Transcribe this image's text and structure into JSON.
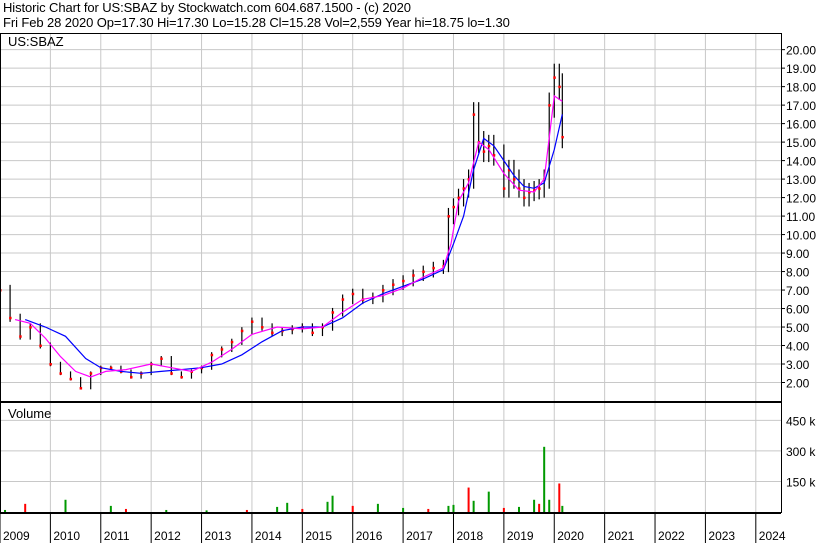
{
  "header": {
    "line1": "Historic Chart for US:SBAZ by Stockwatch.com 604.687.1500 - (c) 2020",
    "line2": "Fri Feb 28 2020   Op=17.30   Hi=17.30   Lo=15.28   Cl=15.28   Vol=2,559   Year hi=18.75   lo=1.30"
  },
  "colors": {
    "price_bar": "#000000",
    "moving_avg_fast": "#ff00ff",
    "moving_avg_slow": "#0000ff",
    "close_marker": "#ff0000",
    "volume_up": "#009900",
    "volume_down": "#ff0000",
    "grid": "#c8c8c8"
  },
  "chart_data": [
    {
      "type": "line",
      "title": "US:SBAZ",
      "y_axis_side": "right",
      "ylim": [
        1.0,
        20.9
      ],
      "y_ticks": [
        "2.00",
        "3.00",
        "4.00",
        "5.00",
        "6.00",
        "7.00",
        "8.00",
        "9.00",
        "10.00",
        "11.00",
        "12.00",
        "13.00",
        "14.00",
        "15.00",
        "16.00",
        "17.00",
        "18.00",
        "19.00",
        "20.00"
      ],
      "x_ticks": [
        "2009",
        "2010",
        "2011",
        "2012",
        "2013",
        "2014",
        "2015",
        "2016",
        "2017",
        "2018",
        "2019",
        "2020",
        "2021",
        "2022",
        "2023",
        "2024"
      ],
      "grid": true,
      "series": [
        {
          "name": "price",
          "x": [
            2009.0,
            2009.2,
            2009.4,
            2009.6,
            2009.8,
            2010.0,
            2010.2,
            2010.4,
            2010.6,
            2010.8,
            2011.0,
            2011.2,
            2011.4,
            2011.6,
            2011.8,
            2012.0,
            2012.2,
            2012.4,
            2012.6,
            2012.8,
            2013.0,
            2013.2,
            2013.4,
            2013.6,
            2013.8,
            2014.0,
            2014.2,
            2014.4,
            2014.6,
            2014.8,
            2015.0,
            2015.2,
            2015.4,
            2015.6,
            2015.8,
            2016.0,
            2016.2,
            2016.4,
            2016.6,
            2016.8,
            2017.0,
            2017.2,
            2017.4,
            2017.6,
            2017.8,
            2017.9,
            2018.0,
            2018.1,
            2018.2,
            2018.3,
            2018.4,
            2018.5,
            2018.6,
            2018.7,
            2018.8,
            2019.0,
            2019.1,
            2019.2,
            2019.3,
            2019.4,
            2019.5,
            2019.6,
            2019.7,
            2019.8,
            2019.9,
            2020.0,
            2020.1,
            2020.16
          ],
          "values": [
            7.0,
            5.5,
            4.5,
            5.0,
            4.0,
            3.0,
            2.5,
            2.2,
            1.7,
            2.5,
            2.8,
            2.8,
            2.6,
            2.3,
            2.5,
            3.0,
            3.3,
            2.5,
            2.3,
            2.6,
            2.8,
            3.5,
            3.8,
            4.2,
            4.8,
            5.3,
            5.0,
            4.7,
            4.8,
            4.9,
            5.0,
            4.7,
            5.0,
            5.8,
            6.5,
            6.8,
            6.5,
            6.6,
            7.0,
            7.3,
            7.5,
            7.8,
            8.0,
            8.2,
            8.3,
            11.0,
            11.5,
            12.0,
            12.5,
            13.0,
            16.5,
            15.0,
            14.5,
            14.8,
            14.3,
            12.5,
            13.5,
            13.0,
            12.5,
            12.0,
            12.3,
            12.4,
            12.5,
            13.0,
            17.0,
            18.5,
            18.0,
            15.28
          ]
        },
        {
          "name": "ma-fast",
          "x": [
            2009.3,
            2009.6,
            2009.9,
            2010.2,
            2010.5,
            2010.8,
            2011.1,
            2011.5,
            2012.0,
            2012.4,
            2012.8,
            2013.2,
            2013.6,
            2014.0,
            2014.5,
            2015.0,
            2015.4,
            2015.8,
            2016.2,
            2016.6,
            2017.0,
            2017.4,
            2017.8,
            2017.95,
            2018.1,
            2018.3,
            2018.5,
            2018.7,
            2019.0,
            2019.3,
            2019.6,
            2019.8,
            2020.0,
            2020.16
          ],
          "values": [
            5.4,
            5.2,
            4.4,
            3.4,
            2.6,
            2.3,
            2.6,
            2.7,
            3.0,
            2.8,
            2.6,
            3.1,
            3.8,
            4.6,
            5.0,
            4.9,
            5.0,
            5.8,
            6.5,
            6.7,
            7.1,
            7.7,
            8.2,
            9.5,
            11.8,
            12.8,
            15.0,
            14.6,
            13.3,
            12.4,
            12.3,
            13.0,
            17.5,
            17.2
          ]
        },
        {
          "name": "ma-slow",
          "x": [
            2009.5,
            2009.9,
            2010.3,
            2010.7,
            2011.0,
            2011.4,
            2011.8,
            2012.2,
            2012.6,
            2013.0,
            2013.4,
            2013.8,
            2014.2,
            2014.6,
            2015.0,
            2015.4,
            2015.8,
            2016.2,
            2016.6,
            2017.0,
            2017.4,
            2017.8,
            2018.0,
            2018.2,
            2018.4,
            2018.6,
            2018.8,
            2019.0,
            2019.2,
            2019.4,
            2019.6,
            2019.8,
            2020.0,
            2020.16
          ],
          "values": [
            5.4,
            5.0,
            4.5,
            3.3,
            2.8,
            2.6,
            2.5,
            2.6,
            2.7,
            2.8,
            3.0,
            3.5,
            4.2,
            4.8,
            5.0,
            5.0,
            5.5,
            6.3,
            6.8,
            7.2,
            7.6,
            8.1,
            9.5,
            11.0,
            13.5,
            15.2,
            14.8,
            14.0,
            13.2,
            12.6,
            12.5,
            12.8,
            14.6,
            16.5
          ]
        }
      ]
    },
    {
      "type": "bar",
      "title": "Volume",
      "y_axis_side": "right",
      "ylim": [
        0,
        540000
      ],
      "y_ticks": [
        "150 k",
        "300 k",
        "450 k"
      ],
      "grid": true,
      "series": [
        {
          "name": "volume",
          "x": [
            2009.1,
            2009.5,
            2010.3,
            2011.2,
            2011.5,
            2012.3,
            2013.1,
            2013.9,
            2014.5,
            2014.7,
            2015.0,
            2015.5,
            2015.6,
            2016.0,
            2016.5,
            2017.0,
            2017.5,
            2017.9,
            2018.0,
            2018.3,
            2018.4,
            2018.7,
            2019.0,
            2019.3,
            2019.6,
            2019.7,
            2019.8,
            2019.9,
            2020.1,
            2020.16
          ],
          "values": [
            10000,
            40000,
            60000,
            30000,
            15000,
            10000,
            8000,
            10000,
            25000,
            45000,
            15000,
            50000,
            80000,
            30000,
            40000,
            20000,
            15000,
            30000,
            35000,
            120000,
            55000,
            100000,
            20000,
            25000,
            60000,
            40000,
            320000,
            60000,
            140000,
            30000
          ]
        }
      ]
    }
  ]
}
